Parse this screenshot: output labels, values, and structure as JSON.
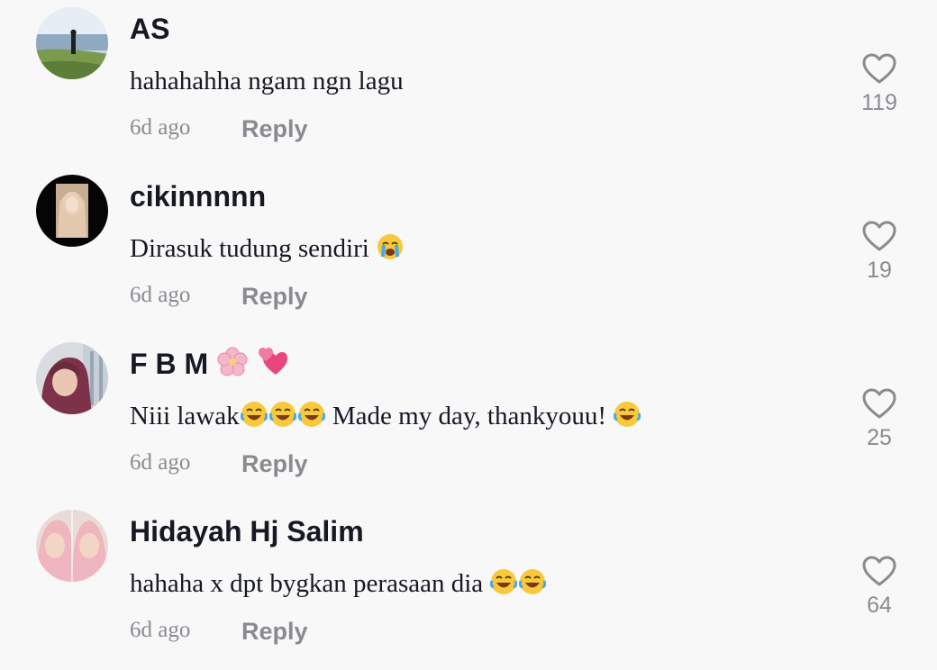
{
  "comments": [
    {
      "username": "AS",
      "text": "hahahahha ngam ngn lagu",
      "time": "6d ago",
      "reply_label": "Reply",
      "likes": "119",
      "text_emojis": []
    },
    {
      "username": "cikinnnnn",
      "text": "Dirasuk tudung sendiri",
      "time": "6d ago",
      "reply_label": "Reply",
      "likes": "19",
      "text_emojis": [
        "loudly-crying-face"
      ]
    },
    {
      "username": "F B M",
      "username_emojis": [
        "cherry-blossom",
        "revolving-hearts"
      ],
      "text": "Niii lawak",
      "text_part2": " Made my day, thankyouu! ",
      "time": "6d ago",
      "reply_label": "Reply",
      "likes": "25"
    },
    {
      "username": "Hidayah Hj Salim",
      "text": "hahaha x dpt bygkan perasaan dia ",
      "time": "6d ago",
      "reply_label": "Reply",
      "likes": "64",
      "text_emojis": [
        "face-with-tears-of-joy",
        "face-with-tears-of-joy"
      ]
    }
  ],
  "colors": {
    "background": "#f8f8f8",
    "primary_text": "#161823",
    "secondary_text": "#8a8b91",
    "heart_outline": "#8a8b91"
  }
}
